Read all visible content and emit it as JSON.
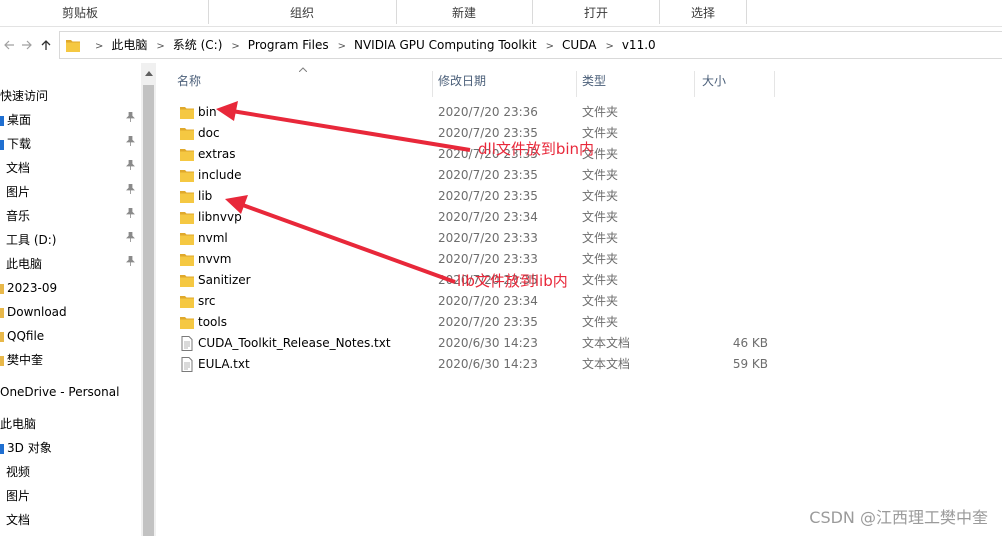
{
  "ribbon": {
    "groups": [
      "剪贴板",
      "组织",
      "新建",
      "打开",
      "选择"
    ]
  },
  "nav": {
    "back_icon": "arrow-left-icon",
    "forward_icon": "arrow-right-icon",
    "up_icon": "arrow-up-icon"
  },
  "address": {
    "crumbs": [
      "此电脑",
      "系统 (C:)",
      "Program Files",
      "NVIDIA GPU Computing Toolkit",
      "CUDA",
      "v11.0"
    ],
    "separator": ">"
  },
  "sidebar": {
    "items": [
      {
        "label": "快速访问",
        "pinned": false,
        "marker": ""
      },
      {
        "label": "桌面",
        "pinned": true,
        "marker": "#1f6fd1"
      },
      {
        "label": "下载",
        "pinned": true,
        "marker": "#1f6fd1"
      },
      {
        "label": "文档",
        "pinned": true,
        "marker": ""
      },
      {
        "label": "图片",
        "pinned": true,
        "marker": ""
      },
      {
        "label": "音乐",
        "pinned": true,
        "marker": ""
      },
      {
        "label": "工具 (D:)",
        "pinned": true,
        "marker": ""
      },
      {
        "label": "此电脑",
        "pinned": true,
        "marker": ""
      },
      {
        "label": "2023-09",
        "pinned": false,
        "marker": "#e8b84a"
      },
      {
        "label": "Download",
        "pinned": false,
        "marker": "#e8b84a"
      },
      {
        "label": "QQfile",
        "pinned": false,
        "marker": "#e8b84a"
      },
      {
        "label": "樊中奎",
        "pinned": false,
        "marker": "#e8b84a"
      },
      {
        "label": "OneDrive - Personal",
        "pinned": false,
        "marker": ""
      },
      {
        "label": "此电脑",
        "pinned": false,
        "marker": ""
      },
      {
        "label": "3D 对象",
        "pinned": false,
        "marker": "#1f6fd1"
      },
      {
        "label": "视频",
        "pinned": false,
        "marker": ""
      },
      {
        "label": "图片",
        "pinned": false,
        "marker": ""
      },
      {
        "label": "文档",
        "pinned": false,
        "marker": ""
      }
    ]
  },
  "columns": {
    "name": "名称",
    "date": "修改日期",
    "type": "类型",
    "size": "大小"
  },
  "files": [
    {
      "name": "bin",
      "date": "2020/7/20 23:36",
      "type": "文件夹",
      "size": "",
      "icon": "folder-icon"
    },
    {
      "name": "doc",
      "date": "2020/7/20 23:35",
      "type": "文件夹",
      "size": "",
      "icon": "folder-icon"
    },
    {
      "name": "extras",
      "date": "2020/7/20 23:35",
      "type": "文件夹",
      "size": "",
      "icon": "folder-icon"
    },
    {
      "name": "include",
      "date": "2020/7/20 23:35",
      "type": "文件夹",
      "size": "",
      "icon": "folder-icon"
    },
    {
      "name": "lib",
      "date": "2020/7/20 23:35",
      "type": "文件夹",
      "size": "",
      "icon": "folder-icon"
    },
    {
      "name": "libnvvp",
      "date": "2020/7/20 23:34",
      "type": "文件夹",
      "size": "",
      "icon": "folder-icon"
    },
    {
      "name": "nvml",
      "date": "2020/7/20 23:33",
      "type": "文件夹",
      "size": "",
      "icon": "folder-icon"
    },
    {
      "name": "nvvm",
      "date": "2020/7/20 23:33",
      "type": "文件夹",
      "size": "",
      "icon": "folder-icon"
    },
    {
      "name": "Sanitizer",
      "date": "2020/7/20 23:35",
      "type": "文件夹",
      "size": "",
      "icon": "folder-icon"
    },
    {
      "name": "src",
      "date": "2020/7/20 23:34",
      "type": "文件夹",
      "size": "",
      "icon": "folder-icon"
    },
    {
      "name": "tools",
      "date": "2020/7/20 23:35",
      "type": "文件夹",
      "size": "",
      "icon": "folder-icon"
    },
    {
      "name": "CUDA_Toolkit_Release_Notes.txt",
      "date": "2020/6/30 14:23",
      "type": "文本文档",
      "size": "46 KB",
      "icon": "text-file-icon"
    },
    {
      "name": "EULA.txt",
      "date": "2020/6/30 14:23",
      "type": "文本文档",
      "size": "59 KB",
      "icon": "text-file-icon"
    }
  ],
  "annotations": {
    "dll_note": "dll文件放到bin内",
    "lib_note": "lib文件放到lib内",
    "color": "#e8283a"
  },
  "watermark": "CSDN @江西理工樊中奎",
  "colors": {
    "folder": "#f5c842",
    "folder_dark": "#e0a92c",
    "header_text": "#4c607a"
  }
}
